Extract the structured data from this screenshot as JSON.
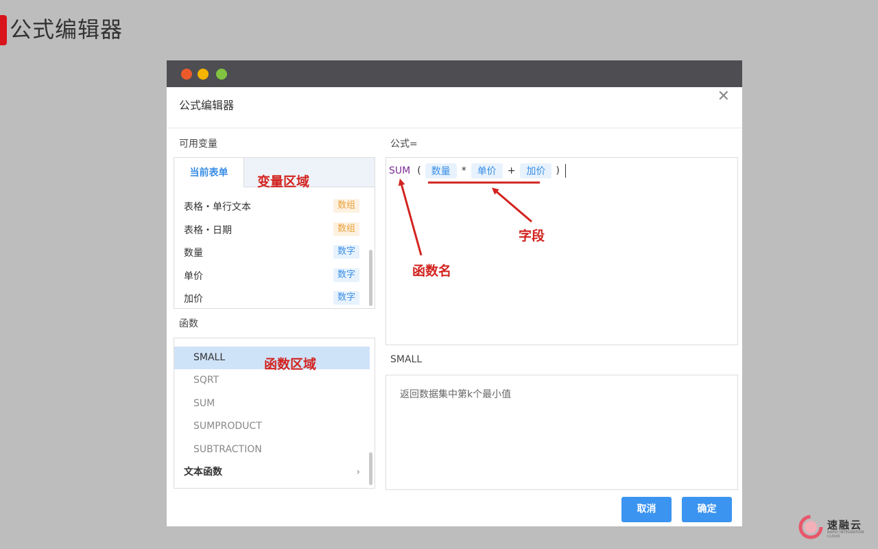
{
  "slide": {
    "title": "公式编辑器"
  },
  "dialog": {
    "title": "公式编辑器",
    "close_glyph": "✕",
    "variables_label": "可用变量",
    "current_form_tab": "当前表单",
    "variables": [
      {
        "name": "表格・单行文本",
        "type": "数组",
        "kind": "array"
      },
      {
        "name": "表格・日期",
        "type": "数组",
        "kind": "array"
      },
      {
        "name": "数量",
        "type": "数字",
        "kind": "number"
      },
      {
        "name": "单价",
        "type": "数字",
        "kind": "number"
      },
      {
        "name": "加价",
        "type": "数字",
        "kind": "number"
      }
    ],
    "functions_label": "函数",
    "functions": [
      "SMALL",
      "SQRT",
      "SUM",
      "SUMPRODUCT",
      "SUBTRACTION"
    ],
    "selected_function": "SMALL",
    "function_category": "文本函数",
    "category_chevron": "›",
    "formula_label": "公式=",
    "formula": {
      "fn": "SUM",
      "open": "(",
      "field1": "数量",
      "op1": "*",
      "field2": "单价",
      "op2": "+",
      "field3": "加价",
      "close": ")"
    },
    "fn_desc_title": "SMALL",
    "fn_desc_text": "返回数据集中第k个最小值",
    "cancel_label": "取消",
    "ok_label": "确定"
  },
  "annotations": {
    "variable_area": "变量区域",
    "function_area": "函数区域",
    "field": "字段",
    "function_name": "函数名"
  },
  "colors": {
    "accent": "#3b94f0",
    "annotation": "#d2231f",
    "brand_red": "#d9141b",
    "fn_purple": "#7a2b8f",
    "tag_array": "#e8a23a",
    "tag_number": "#3a8ee6"
  },
  "logo": {
    "name": "速融云",
    "tagline": "RAPID INTEGRATION CLOUD"
  }
}
